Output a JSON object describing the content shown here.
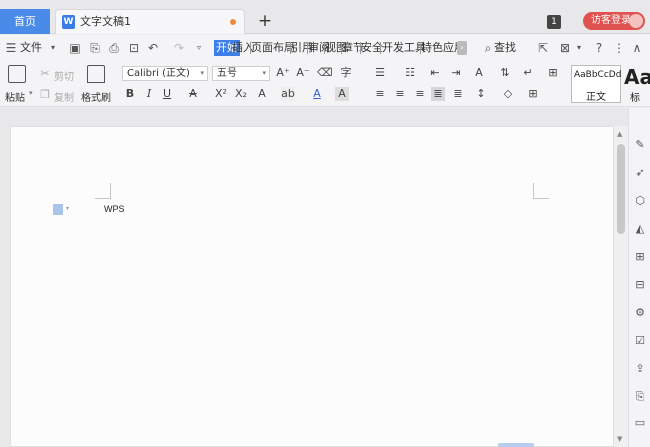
{
  "titlebar": {
    "home_tab": "首页",
    "doc_tab": "文字文稿1",
    "new_tab": "+",
    "badge_count": "1",
    "login": "访客登录"
  },
  "menubar": {
    "file": "文件",
    "tabs": [
      "开始",
      "插入",
      "页面布局",
      "引用",
      "审阅",
      "视图",
      "章节",
      "安全",
      "开发工具",
      "特色应用"
    ],
    "search": "查找",
    "help": "?"
  },
  "ribbon": {
    "paste": "粘贴",
    "cut": "剪切",
    "copy": "复制",
    "format_painter": "格式刷",
    "font_name": "Calibri (正文)",
    "font_size": "五号",
    "style_sample": "AaBbCcDd",
    "style_name": "正文",
    "style2_sample": "Aa",
    "style2_name": "标"
  },
  "document": {
    "text": "WPS"
  },
  "colors": {
    "accent": "#3d7ee9",
    "login": "#e0524f",
    "tab_dot": "#f0893b"
  }
}
